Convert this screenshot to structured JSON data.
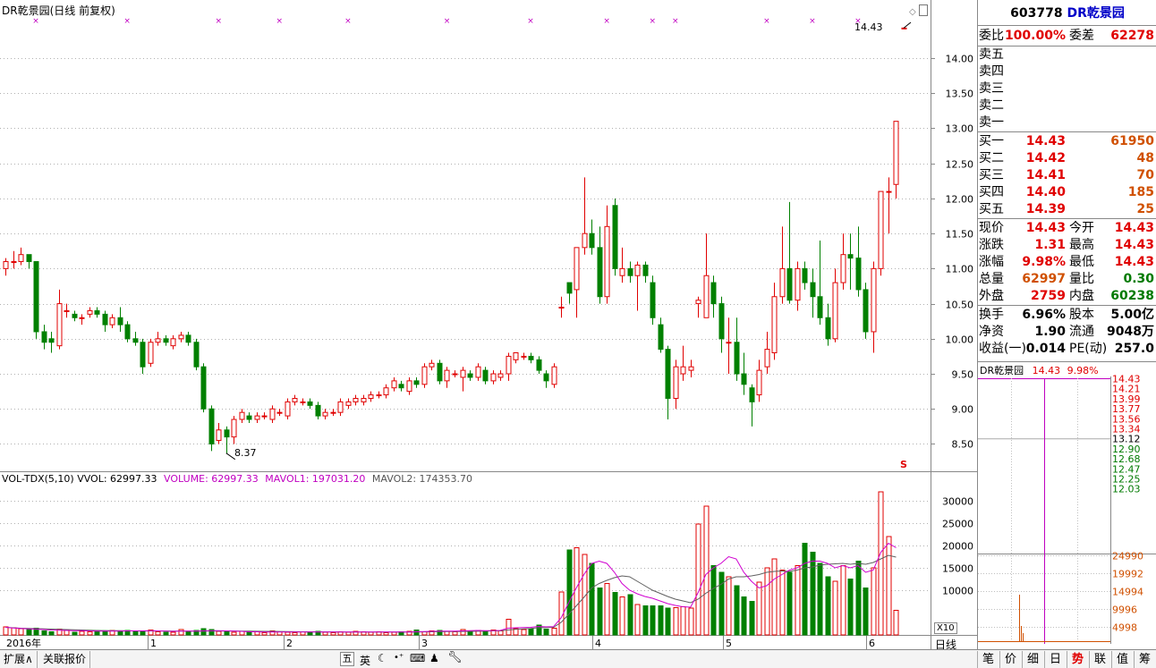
{
  "chart": {
    "title": "DR乾景园(日线 前复权)",
    "last_price_label": "14.43",
    "low_label": "8.37",
    "y_ticks": [
      "14.00",
      "13.50",
      "13.00",
      "12.50",
      "12.00",
      "11.50",
      "11.00",
      "10.50",
      "10.00",
      "9.50",
      "9.00",
      "8.50"
    ],
    "x_labels": [
      "2016年",
      "1",
      "2",
      "3",
      "4",
      "5",
      "6"
    ],
    "period_tab": "日线",
    "vol_header": {
      "name": "VOL-TDX(5,10)",
      "vvol": "VVOL: 62997.33",
      "volume": "VOLUME: 62997.33",
      "mavol1": "MAVOL1: 197031.20",
      "mavol2": "MAVOL2: 174353.70"
    },
    "vol_ticks": [
      "30000",
      "25000",
      "20000",
      "15000",
      "10000"
    ],
    "vol_unit": "X10",
    "s_marker": "S"
  },
  "chart_data": {
    "type": "candlestick",
    "price_range": [
      8.2,
      14.6
    ],
    "volume_range": [
      0,
      33000
    ],
    "candles": [
      [
        11.0,
        11.1,
        10.9,
        11.15
      ],
      [
        11.1,
        11.1,
        11.0,
        11.25
      ],
      [
        11.1,
        11.2,
        11.05,
        11.3
      ],
      [
        11.2,
        11.1,
        11.0,
        11.2
      ],
      [
        11.1,
        10.1,
        10.0,
        11.1
      ],
      [
        10.1,
        9.95,
        9.85,
        10.2
      ],
      [
        10.0,
        9.95,
        9.8,
        10.1
      ],
      [
        9.9,
        10.5,
        9.85,
        10.7
      ],
      [
        10.4,
        10.4,
        10.3,
        10.5
      ],
      [
        10.35,
        10.3,
        10.25,
        10.4
      ],
      [
        10.3,
        10.3,
        10.2,
        10.35
      ],
      [
        10.35,
        10.4,
        10.3,
        10.45
      ],
      [
        10.4,
        10.35,
        10.3,
        10.45
      ],
      [
        10.35,
        10.2,
        10.1,
        10.4
      ],
      [
        10.2,
        10.3,
        10.15,
        10.35
      ],
      [
        10.3,
        10.2,
        10.1,
        10.45
      ],
      [
        10.2,
        10.0,
        9.95,
        10.25
      ],
      [
        10.0,
        9.95,
        9.9,
        10.1
      ],
      [
        9.95,
        9.6,
        9.5,
        10.0
      ],
      [
        9.65,
        9.95,
        9.6,
        10.0
      ],
      [
        9.95,
        10.0,
        9.9,
        10.1
      ],
      [
        10.0,
        9.95,
        9.9,
        10.05
      ],
      [
        9.9,
        10.0,
        9.85,
        10.05
      ],
      [
        10.0,
        10.05,
        9.95,
        10.1
      ],
      [
        10.05,
        9.95,
        9.9,
        10.1
      ],
      [
        9.95,
        9.6,
        9.55,
        10.0
      ],
      [
        9.6,
        9.0,
        8.95,
        9.65
      ],
      [
        9.0,
        8.5,
        8.4,
        9.05
      ],
      [
        8.55,
        8.7,
        8.5,
        8.8
      ],
      [
        8.7,
        8.6,
        8.37,
        8.75
      ],
      [
        8.6,
        8.85,
        8.5,
        8.9
      ],
      [
        8.85,
        8.95,
        8.8,
        9.0
      ],
      [
        8.9,
        8.85,
        8.8,
        8.95
      ],
      [
        8.85,
        8.9,
        8.8,
        8.95
      ],
      [
        8.9,
        8.9,
        8.85,
        8.95
      ],
      [
        8.85,
        9.0,
        8.8,
        9.05
      ],
      [
        8.95,
        8.95,
        8.9,
        9.0
      ],
      [
        8.9,
        9.1,
        8.85,
        9.15
      ],
      [
        9.1,
        9.15,
        9.05,
        9.2
      ],
      [
        9.1,
        9.1,
        9.05,
        9.15
      ],
      [
        9.1,
        9.05,
        9.0,
        9.15
      ],
      [
        9.05,
        8.9,
        8.85,
        9.1
      ],
      [
        8.9,
        8.95,
        8.85,
        9.0
      ],
      [
        8.95,
        8.95,
        8.9,
        9.0
      ],
      [
        8.95,
        9.1,
        8.9,
        9.15
      ],
      [
        9.05,
        9.1,
        9.0,
        9.15
      ],
      [
        9.1,
        9.15,
        9.05,
        9.2
      ],
      [
        9.1,
        9.15,
        9.05,
        9.2
      ],
      [
        9.15,
        9.2,
        9.1,
        9.25
      ],
      [
        9.2,
        9.2,
        9.15,
        9.25
      ],
      [
        9.2,
        9.3,
        9.15,
        9.35
      ],
      [
        9.3,
        9.4,
        9.25,
        9.45
      ],
      [
        9.35,
        9.3,
        9.25,
        9.4
      ],
      [
        9.25,
        9.4,
        9.2,
        9.45
      ],
      [
        9.4,
        9.35,
        9.3,
        9.45
      ],
      [
        9.35,
        9.6,
        9.3,
        9.65
      ],
      [
        9.6,
        9.65,
        9.55,
        9.7
      ],
      [
        9.65,
        9.4,
        9.35,
        9.7
      ],
      [
        9.4,
        9.55,
        9.3,
        9.6
      ],
      [
        9.5,
        9.5,
        9.45,
        9.55
      ],
      [
        9.45,
        9.55,
        9.25,
        9.6
      ],
      [
        9.5,
        9.45,
        9.4,
        9.55
      ],
      [
        9.45,
        9.6,
        9.4,
        9.65
      ],
      [
        9.55,
        9.4,
        9.35,
        9.6
      ],
      [
        9.4,
        9.5,
        9.35,
        9.55
      ],
      [
        9.45,
        9.5,
        9.4,
        9.55
      ],
      [
        9.5,
        9.75,
        9.4,
        9.8
      ],
      [
        9.7,
        9.8,
        9.65,
        9.8
      ],
      [
        9.75,
        9.75,
        9.7,
        9.8
      ],
      [
        9.75,
        9.7,
        9.65,
        9.8
      ],
      [
        9.7,
        9.55,
        9.5,
        9.75
      ],
      [
        9.5,
        9.4,
        9.3,
        9.55
      ],
      [
        9.35,
        9.6,
        9.3,
        9.65
      ],
      [
        10.45,
        10.45,
        10.3,
        10.6
      ],
      [
        10.8,
        10.65,
        10.5,
        10.8
      ],
      [
        10.7,
        11.3,
        10.3,
        11.3
      ],
      [
        11.3,
        11.5,
        11.2,
        12.3
      ],
      [
        11.5,
        11.3,
        11.2,
        11.7
      ],
      [
        11.3,
        10.6,
        10.5,
        11.6
      ],
      [
        10.6,
        11.6,
        10.5,
        11.9
      ],
      [
        11.9,
        11.0,
        10.9,
        12.0
      ],
      [
        10.9,
        11.0,
        10.8,
        11.3
      ],
      [
        11.0,
        10.9,
        10.8,
        11.1
      ],
      [
        10.9,
        11.05,
        10.4,
        11.1
      ],
      [
        11.05,
        10.9,
        10.8,
        11.1
      ],
      [
        10.8,
        10.3,
        10.2,
        10.9
      ],
      [
        10.2,
        9.85,
        9.8,
        10.3
      ],
      [
        9.85,
        9.15,
        8.85,
        9.9
      ],
      [
        9.15,
        9.6,
        9.0,
        9.7
      ],
      [
        9.5,
        9.6,
        9.4,
        9.9
      ],
      [
        9.55,
        9.6,
        9.45,
        9.7
      ],
      [
        10.5,
        10.55,
        10.3,
        10.6
      ],
      [
        10.3,
        10.9,
        10.3,
        11.5
      ],
      [
        10.8,
        10.5,
        10.3,
        10.9
      ],
      [
        10.5,
        10.0,
        9.8,
        10.6
      ],
      [
        9.95,
        9.95,
        9.5,
        10.3
      ],
      [
        9.95,
        9.5,
        9.4,
        10.3
      ],
      [
        9.5,
        9.35,
        9.2,
        9.8
      ],
      [
        9.3,
        9.1,
        8.75,
        9.35
      ],
      [
        9.2,
        9.55,
        9.1,
        9.7
      ],
      [
        9.6,
        9.85,
        9.5,
        10.1
      ],
      [
        9.8,
        10.6,
        9.7,
        10.8
      ],
      [
        10.6,
        11.0,
        10.5,
        11.6
      ],
      [
        11.0,
        10.55,
        10.5,
        11.95
      ],
      [
        10.55,
        11.0,
        10.4,
        11.1
      ],
      [
        11.0,
        10.8,
        10.7,
        11.1
      ],
      [
        10.8,
        10.6,
        10.3,
        11.0
      ],
      [
        10.6,
        10.3,
        10.2,
        11.4
      ],
      [
        10.3,
        10.0,
        9.9,
        10.5
      ],
      [
        10.0,
        10.8,
        9.95,
        11.0
      ],
      [
        10.8,
        11.2,
        10.7,
        11.5
      ],
      [
        11.2,
        11.15,
        10.7,
        11.5
      ],
      [
        11.15,
        10.7,
        10.6,
        11.6
      ],
      [
        10.7,
        10.1,
        10.0,
        10.8
      ],
      [
        10.1,
        11.0,
        9.8,
        11.1
      ],
      [
        11.0,
        12.1,
        10.9,
        12.1
      ],
      [
        12.1,
        12.1,
        11.5,
        12.3
      ],
      [
        12.2,
        13.1,
        12.0,
        13.1
      ],
      [
        14.43,
        14.43,
        14.43,
        14.43
      ]
    ],
    "volumes": [
      1800,
      1600,
      1400,
      1200,
      1500,
      900,
      700,
      1300,
      1000,
      600,
      800,
      700,
      900,
      700,
      1000,
      900,
      1000,
      800,
      700,
      1100,
      700,
      600,
      600,
      1200,
      700,
      1000,
      1400,
      1200,
      800,
      700,
      600,
      800,
      600,
      700,
      500,
      900,
      700,
      600,
      500,
      700,
      600,
      800,
      600,
      500,
      700,
      600,
      800,
      700,
      600,
      700,
      500,
      600,
      700,
      800,
      1100,
      700,
      900,
      1000,
      800,
      700,
      1200,
      900,
      1000,
      800,
      1100,
      900,
      3500,
      1400,
      1200,
      1300,
      2200,
      1300,
      1500,
      9600,
      19000,
      19500,
      18000,
      16000,
      10500,
      11500,
      9500,
      8500,
      9000,
      6800,
      6500,
      6500,
      6500,
      6000,
      6100,
      6300,
      6000,
      24800,
      28800,
      15500,
      14000,
      13000,
      11000,
      8500,
      7500,
      11800,
      15000,
      17000,
      14500,
      14000,
      15500,
      20500,
      18500,
      16000,
      13000,
      12000,
      15500,
      12500,
      16500,
      10500,
      15000,
      32000,
      22000,
      5500
    ],
    "vol_colors_note": "red hollow = up day, green filled = down day",
    "mavol1_values": [
      1700,
      1550,
      1450,
      1350,
      1300,
      1200,
      1100,
      1050,
      1000,
      950,
      950,
      900,
      850,
      850,
      850,
      850,
      900,
      900,
      900,
      950,
      900,
      850,
      800,
      850,
      850,
      850,
      900,
      950,
      950,
      900,
      850,
      800,
      700,
      700,
      650,
      650,
      650,
      650,
      650,
      650,
      650,
      650,
      650,
      650,
      650,
      650,
      650,
      650,
      650,
      650,
      650,
      650,
      650,
      650,
      700,
      750,
      800,
      850,
      850,
      850,
      900,
      950,
      1000,
      950,
      950,
      1000,
      1500,
      1600,
      1650,
      1700,
      1900,
      1800,
      1850,
      3800,
      7200,
      10500,
      13500,
      16000,
      16500,
      16000,
      14000,
      11500,
      10000,
      9200,
      8600,
      8200,
      7600,
      7000,
      6600,
      6300,
      6200,
      9500,
      13500,
      15000,
      16000,
      17500,
      17000,
      14000,
      12000,
      10500,
      11000,
      12500,
      13500,
      14500,
      15000,
      16000,
      16500,
      16500,
      16000,
      15000,
      15500,
      15000,
      15500,
      14000,
      14500,
      18500,
      20500,
      19500
    ],
    "mavol2_values": [
      1700,
      1600,
      1500,
      1450,
      1400,
      1350,
      1300,
      1250,
      1200,
      1150,
      1100,
      1050,
      1000,
      980,
      960,
      940,
      920,
      900,
      880,
      880,
      880,
      870,
      860,
      860,
      860,
      860,
      860,
      870,
      880,
      880,
      870,
      860,
      850,
      830,
      810,
      790,
      770,
      750,
      730,
      710,
      700,
      690,
      680,
      670,
      660,
      650,
      650,
      650,
      650,
      650,
      650,
      650,
      650,
      650,
      660,
      680,
      700,
      720,
      740,
      760,
      780,
      800,
      830,
      860,
      890,
      920,
      1100,
      1250,
      1350,
      1450,
      1600,
      1650,
      1700,
      2800,
      4600,
      6500,
      8400,
      10500,
      11500,
      12200,
      12800,
      13200,
      13000,
      12000,
      11000,
      10000,
      9300,
      8600,
      8000,
      7600,
      7200,
      8000,
      9300,
      10400,
      11300,
      12500,
      13000,
      13000,
      13200,
      13500,
      14000,
      14200,
      14300,
      14200,
      14500,
      15000,
      15200,
      15600,
      15800,
      15900,
      16000,
      15800,
      16000,
      15800,
      16200,
      17000,
      17800,
      17400
    ]
  },
  "quote": {
    "code": "603778",
    "name": "DR乾景园",
    "weibi_label": "委比",
    "weibi": "100.00%",
    "weicha_label": "委差",
    "weicha": "62278",
    "sell": [
      {
        "label": "卖五",
        "price": "",
        "vol": ""
      },
      {
        "label": "卖四",
        "price": "",
        "vol": ""
      },
      {
        "label": "卖三",
        "price": "",
        "vol": ""
      },
      {
        "label": "卖二",
        "price": "",
        "vol": ""
      },
      {
        "label": "卖一",
        "price": "",
        "vol": ""
      }
    ],
    "buy": [
      {
        "label": "买一",
        "price": "14.43",
        "vol": "61950"
      },
      {
        "label": "买二",
        "price": "14.42",
        "vol": "48"
      },
      {
        "label": "买三",
        "price": "14.41",
        "vol": "70"
      },
      {
        "label": "买四",
        "price": "14.40",
        "vol": "185"
      },
      {
        "label": "买五",
        "price": "14.39",
        "vol": "25"
      }
    ],
    "stats": [
      {
        "l1": "现价",
        "v1": "14.43",
        "c1": "red",
        "l2": "今开",
        "v2": "14.43",
        "c2": "red"
      },
      {
        "l1": "涨跌",
        "v1": "1.31",
        "c1": "red",
        "l2": "最高",
        "v2": "14.43",
        "c2": "red"
      },
      {
        "l1": "涨幅",
        "v1": "9.98%",
        "c1": "red",
        "l2": "最低",
        "v2": "14.43",
        "c2": "red"
      },
      {
        "l1": "总量",
        "v1": "62997",
        "c1": "orange",
        "l2": "量比",
        "v2": "0.30",
        "c2": "green"
      },
      {
        "l1": "外盘",
        "v1": "2759",
        "c1": "red",
        "l2": "内盘",
        "v2": "60238",
        "c2": "green"
      }
    ],
    "fin": [
      {
        "l1": "换手",
        "v1": "6.96%",
        "l2": "股本",
        "v2": "5.00亿"
      },
      {
        "l1": "净资",
        "v1": "1.90",
        "l2": "流通",
        "v2": "9048万"
      },
      {
        "l1": "收益(一)",
        "v1": "0.014",
        "l2": "PE(动)",
        "v2": "257.0"
      }
    ]
  },
  "mini": {
    "name": "DR乾景园",
    "price": "14.43",
    "pct": "9.98%",
    "price_ticks": [
      "14.43",
      "14.21",
      "13.99",
      "13.77",
      "13.56",
      "13.34",
      "13.12",
      "12.90",
      "12.68",
      "12.47",
      "12.25",
      "12.03"
    ],
    "vol_ticks": [
      "24990",
      "19992",
      "14994",
      "9996",
      "4998"
    ]
  },
  "bottom": {
    "left_tabs": [
      "扩展∧",
      "关联报价"
    ],
    "icons": [
      "五",
      "英"
    ],
    "right_tabs": [
      "笔",
      "价",
      "细",
      "日",
      "势",
      "联",
      "值",
      "筹"
    ]
  },
  "colors": {
    "up": "#e00000",
    "down": "#008000",
    "grid": "#b0b0b0",
    "ma1": "#d000d0",
    "ma2": "#606060"
  }
}
